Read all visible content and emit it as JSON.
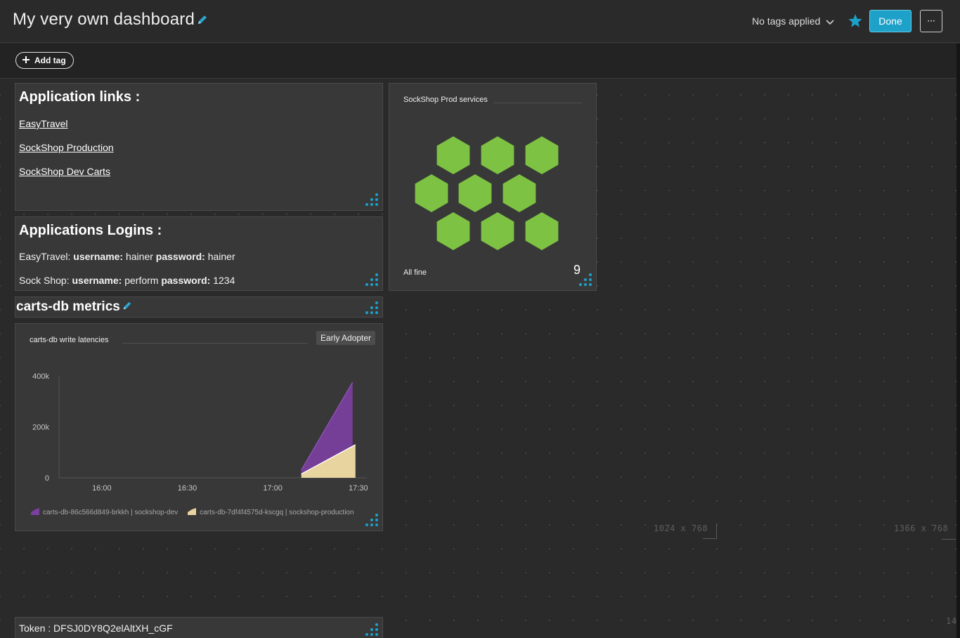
{
  "header": {
    "title": "My very own dashboard",
    "tags_label": "No tags applied",
    "done_label": "Done",
    "more_label": "···",
    "accent_color": "#1da1c9"
  },
  "tagbar": {
    "add_tag_label": "Add tag"
  },
  "app_links": {
    "heading": "Application links :",
    "links": [
      "EasyTravel",
      "SockShop Production",
      "SockShop Dev Carts"
    ]
  },
  "app_logins": {
    "heading": "Applications Logins :",
    "rows": [
      {
        "app": "EasyTravel:",
        "user_key": "username:",
        "user": "hainer",
        "pass_key": "password:",
        "pass": "hainer"
      },
      {
        "app": "Sock Shop:",
        "user_key": "username:",
        "user": "perform",
        "pass_key": "password:",
        "pass": "1234"
      }
    ]
  },
  "services_tile": {
    "title": "SockShop Prod services",
    "status": "All fine",
    "count": "9",
    "hex_color": "#7dc242"
  },
  "section_header": {
    "title": "carts-db metrics"
  },
  "chart_tile": {
    "title": "carts-db write latencies",
    "badge": "Early Adopter"
  },
  "chart_data": {
    "type": "area",
    "title": "carts-db write latencies",
    "x_ticks": [
      "16:00",
      "16:30",
      "17:00",
      "17:30"
    ],
    "y_ticks": [
      "400k",
      "200k",
      "0"
    ],
    "ylim": [
      0,
      400000
    ],
    "xlim": [
      "15:45",
      "17:33"
    ],
    "series": [
      {
        "name": "carts-db-86c566d849-brkkh | sockshop-dev",
        "color": "#7b3fa0",
        "x": [
          "17:10",
          "17:28"
        ],
        "y": [
          30000,
          375000
        ]
      },
      {
        "name": "carts-db-7df4f4575d-kscgq | sockshop-production",
        "color": "#e8d49e",
        "x": [
          "17:10",
          "17:29"
        ],
        "y": [
          15000,
          130000
        ]
      }
    ]
  },
  "token": {
    "label": "Token : DFSJ0DY8Q2elAltXH_cGF"
  },
  "canvas_marks": {
    "small": "1024 x 768",
    "large": "1366 x 768",
    "edge": "14"
  }
}
